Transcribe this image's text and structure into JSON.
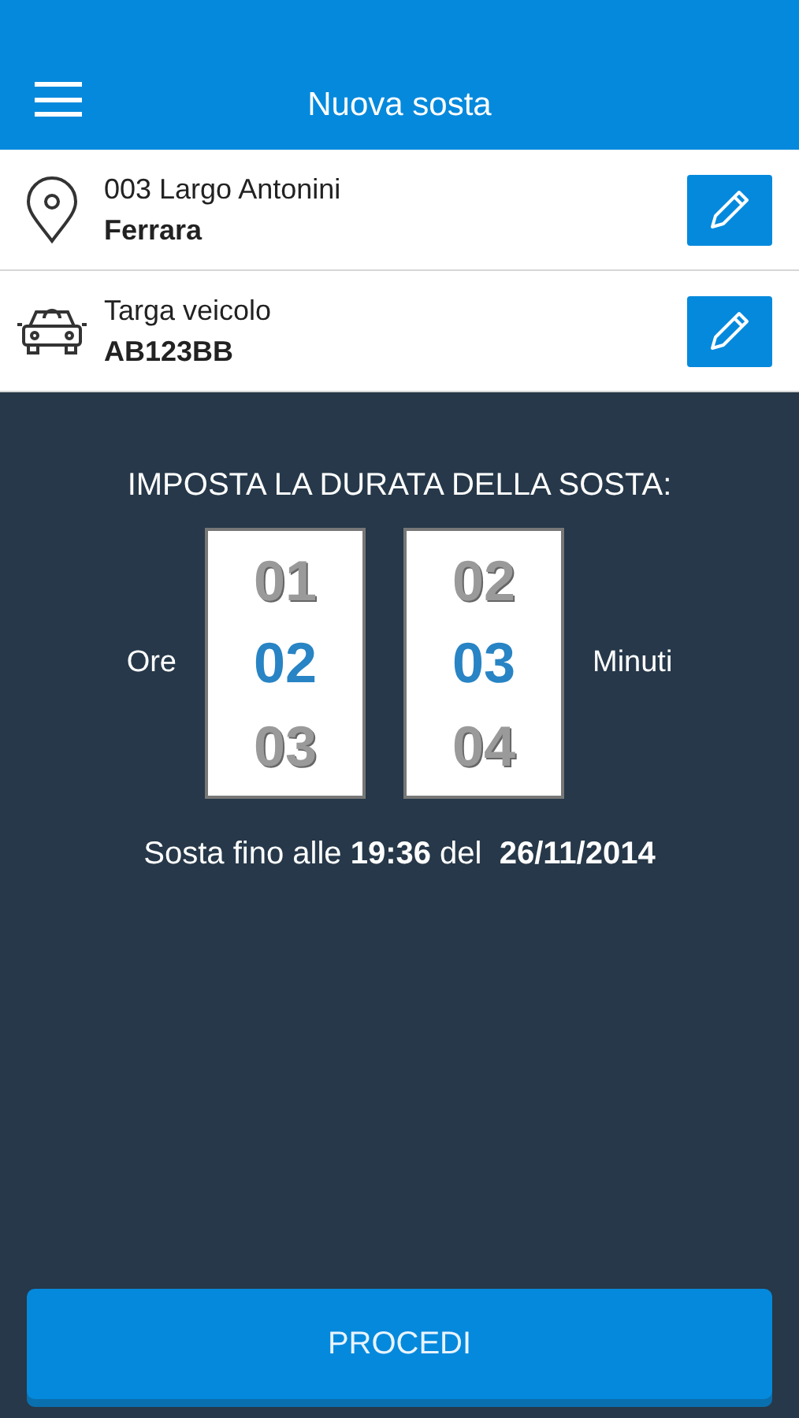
{
  "app_bar": {
    "title": "Nuova sosta"
  },
  "info_rows": [
    {
      "kind": "location",
      "line_1": "003 Largo Antonini",
      "line_2": "Ferrara"
    },
    {
      "kind": "vehicle",
      "line_1": "Targa veicolo",
      "line_2": "AB123BB"
    }
  ],
  "duration": {
    "heading": "IMPOSTA LA DURATA DELLA SOSTA:",
    "pickers": [
      {
        "label": "Ore",
        "kind": "label_before",
        "values": [
          {
            "text": "01",
            "selected": false
          },
          {
            "text": "02",
            "selected": true
          },
          {
            "text": "03",
            "selected": false
          }
        ]
      },
      {
        "label": "Minuti",
        "kind": "label_after",
        "values": [
          {
            "text": "02",
            "selected": false
          },
          {
            "text": "03",
            "selected": true
          },
          {
            "text": "04",
            "selected": false
          }
        ]
      }
    ],
    "summary": "Sosta fino alle **19:36** del  **26/11/2014**"
  },
  "button": "PROCEDI"
}
